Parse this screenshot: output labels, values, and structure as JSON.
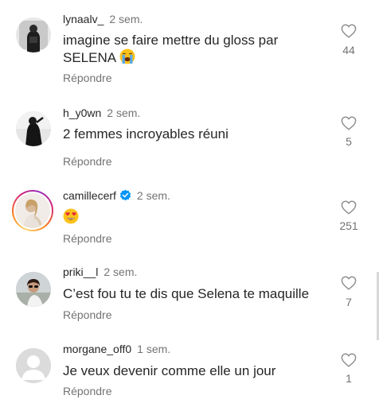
{
  "comments": [
    {
      "username": "lynaalv_",
      "time": "2 sem.",
      "text": "imagine se faire mettre du gloss par SELENA",
      "emoji": "loudly-crying-face-emoji",
      "reply": "Répondre",
      "likes": "44"
    },
    {
      "username": "h_y0wn",
      "time": "2 sem.",
      "text": "2 femmes incroyables réuni",
      "reply": "Répondre",
      "likes": "5"
    },
    {
      "username": "camillecerf",
      "time": "2 sem.",
      "verified": true,
      "text": "",
      "emoji": "heart-eyes-emoji",
      "reply": "Répondre",
      "likes": "251"
    },
    {
      "username": "priki__l",
      "time": "2 sem.",
      "text": "C’est fou tu te dis que Selena te maquille",
      "reply": "Répondre",
      "likes": "7"
    },
    {
      "username": "morgane_off0",
      "time": "1 sem.",
      "text": "Je veux devenir comme elle un jour",
      "reply": "Répondre",
      "likes": "1"
    }
  ],
  "colors": {
    "text": "#262626",
    "secondary": "#737373",
    "verified": "#0095f6"
  }
}
